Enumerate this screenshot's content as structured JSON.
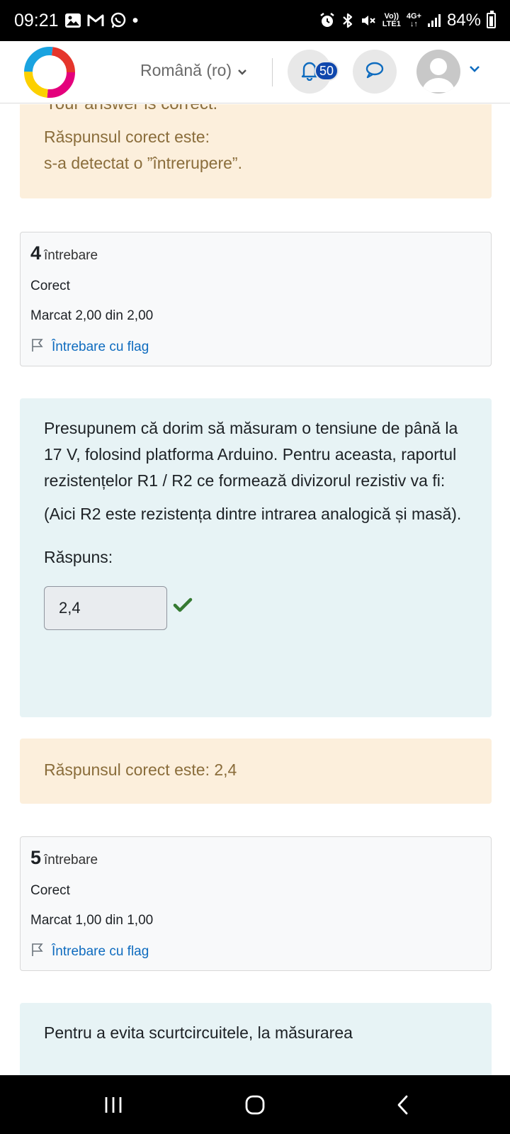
{
  "status_bar": {
    "time": "09:21",
    "dot": "•",
    "net_top": "Vo))",
    "net_bottom": "LTE1",
    "gen_top": "4G+",
    "gen_bottom": "↓↑",
    "battery": "84%"
  },
  "header": {
    "language": "Română (ro)",
    "notification_count": "50",
    "colors": {
      "badge": "#0f47ad",
      "link": "#0f6cbf"
    }
  },
  "main": {
    "cutoff_text": "Your answer is correct.",
    "q3_feedback": {
      "line1": "Răspunsul corect este:",
      "line2": "s-a detectat o ”întrerupere”."
    },
    "q4": {
      "number": "4",
      "label": "întrebare",
      "status": "Corect",
      "mark": "Marcat 2,00 din 2,00",
      "flag": "Întrebare cu flag",
      "text_p1": "Presupunem că dorim să măsuram o tensiune de până la 17 V, folosind platforma Arduino. Pentru aceasta, raportul rezistențelor R1 / R2 ce formează divizorul rezistiv va fi:",
      "text_p2": "(Aici R2 este rezistența dintre intrarea analogică și masă).",
      "answer_label": "Răspuns:",
      "answer_value": "2,4",
      "feedback": "Răspunsul corect este: 2,4"
    },
    "q5": {
      "number": "5",
      "label": "întrebare",
      "status": "Corect",
      "mark": "Marcat 1,00 din 1,00",
      "flag": "Întrebare cu flag",
      "text_start": "Pentru a evita scurtcircuitele, la măsurarea"
    }
  }
}
